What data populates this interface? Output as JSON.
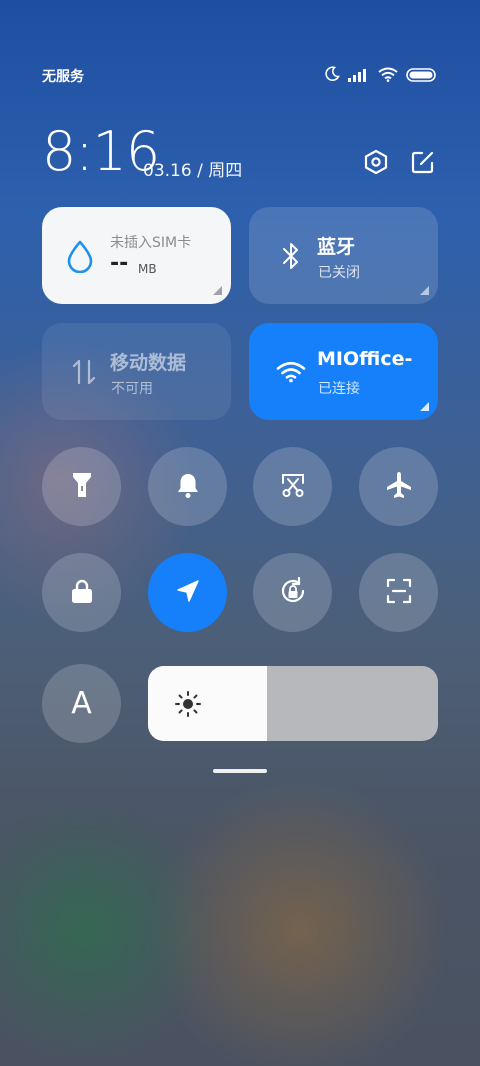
{
  "status_bar": {
    "carrier": "无服务",
    "icons": [
      "moon-icon",
      "signal-icon",
      "wifi-icon",
      "battery-icon"
    ]
  },
  "header": {
    "time": "8:16",
    "date": "03.16 / 周四",
    "settings_icon": "hexagon-settings-icon",
    "edit_icon": "edit-icon"
  },
  "tiles": {
    "data_usage": {
      "title": "未插入SIM卡",
      "value": "--",
      "unit": "MB",
      "icon": "water-drop-icon"
    },
    "bluetooth": {
      "title": "蓝牙",
      "status": "已关闭",
      "icon": "bluetooth-icon"
    },
    "mobile_data": {
      "title": "移动数据",
      "status": "不可用",
      "icon": "arrows-updown-icon"
    },
    "wifi": {
      "title": "MIOffice-",
      "status": "已连接",
      "icon": "wifi-icon"
    }
  },
  "toggles": [
    {
      "name": "flashlight",
      "icon": "flashlight-icon",
      "active": false
    },
    {
      "name": "mute",
      "icon": "bell-icon",
      "active": false
    },
    {
      "name": "screenshot",
      "icon": "scissors-icon",
      "active": false
    },
    {
      "name": "airplane-mode",
      "icon": "airplane-icon",
      "active": false
    },
    {
      "name": "lock-screen",
      "icon": "lock-icon",
      "active": false
    },
    {
      "name": "location",
      "icon": "location-arrow-icon",
      "active": true
    },
    {
      "name": "rotation-lock",
      "icon": "rotate-lock-icon",
      "active": false
    },
    {
      "name": "scanner",
      "icon": "scan-icon",
      "active": false
    }
  ],
  "auto_brightness": {
    "label": "A",
    "icon": "auto-brightness-icon"
  },
  "brightness": {
    "level": 0.41,
    "icon": "sun-icon"
  },
  "colors": {
    "accent": "#1680fb",
    "tile_white": "#f5f6f8",
    "drop_blue": "#1e90f0"
  }
}
